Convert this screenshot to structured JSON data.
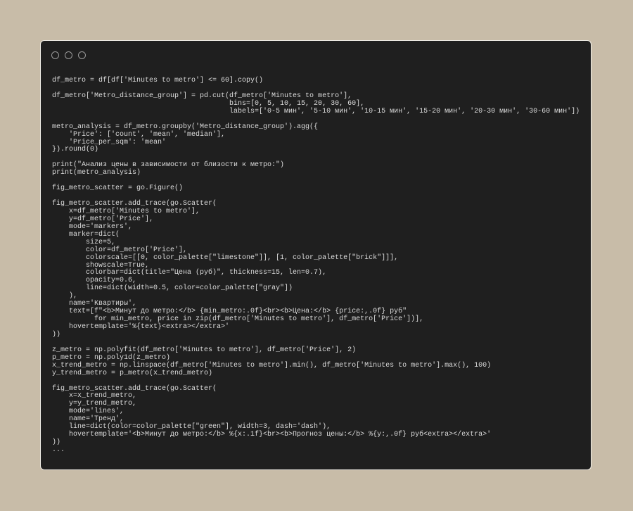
{
  "window": {
    "controls": [
      "close",
      "minimize",
      "maximize"
    ]
  },
  "code_lines": [
    "df_metro = df[df['Minutes to metro'] <= 60].copy()",
    "",
    "df_metro['Metro_distance_group'] = pd.cut(df_metro['Minutes to metro'],",
    "                                          bins=[0, 5, 10, 15, 20, 30, 60],",
    "                                          labels=['0-5 мин', '5-10 мин', '10-15 мин', '15-20 мин', '20-30 мин', '30-60 мин'])",
    "",
    "metro_analysis = df_metro.groupby('Metro_distance_group').agg({",
    "    'Price': ['count', 'mean', 'median'],",
    "    'Price_per_sqm': 'mean'",
    "}).round(0)",
    "",
    "print(\"Анализ цены в зависимости от близости к метро:\")",
    "print(metro_analysis)",
    "",
    "fig_metro_scatter = go.Figure()",
    "",
    "fig_metro_scatter.add_trace(go.Scatter(",
    "    x=df_metro['Minutes to metro'],",
    "    y=df_metro['Price'],",
    "    mode='markers',",
    "    marker=dict(",
    "        size=5,",
    "        color=df_metro['Price'],",
    "        colorscale=[[0, color_palette[\"limestone\"]], [1, color_palette[\"brick\"]]],",
    "        showscale=True,",
    "        colorbar=dict(title=\"Цена (руб)\", thickness=15, len=0.7),",
    "        opacity=0.6,",
    "        line=dict(width=0.5, color=color_palette[\"gray\"])",
    "    ),",
    "    name='Квартиры',",
    "    text=[f\"<b>Минут до метро:</b> {min_metro:.0f}<br><b>Цена:</b> {price:,.0f} руб\"",
    "          for min_metro, price in zip(df_metro['Minutes to metro'], df_metro['Price'])],",
    "    hovertemplate='%{text}<extra></extra>'",
    "))",
    "",
    "z_metro = np.polyfit(df_metro['Minutes to metro'], df_metro['Price'], 2)",
    "p_metro = np.poly1d(z_metro)",
    "x_trend_metro = np.linspace(df_metro['Minutes to metro'].min(), df_metro['Minutes to metro'].max(), 100)",
    "y_trend_metro = p_metro(x_trend_metro)",
    "",
    "fig_metro_scatter.add_trace(go.Scatter(",
    "    x=x_trend_metro,",
    "    y=y_trend_metro,",
    "    mode='lines',",
    "    name='Тренд',",
    "    line=dict(color=color_palette[\"green\"], width=3, dash='dash'),",
    "    hovertemplate='<b>Минут до метро:</b> %{x:.1f}<br><b>Прогноз цены:</b> %{y:,.0f} руб<extra></extra>'",
    "))",
    "..."
  ]
}
